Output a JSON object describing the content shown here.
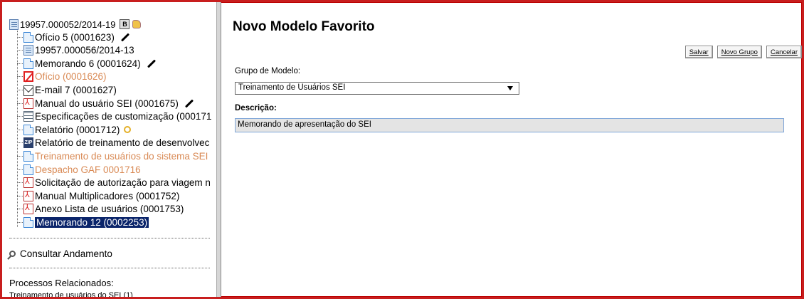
{
  "tree": {
    "root": {
      "label": "19957.000052/2014-19",
      "badge": "B"
    },
    "items": [
      {
        "label": "Ofício 5 (0001623)",
        "icon": "document-icon",
        "marker": "pencil",
        "faded": false
      },
      {
        "label": "19957.000056/2014-13",
        "icon": "process-icon",
        "marker": "",
        "faded": false
      },
      {
        "label": "Memorando 6 (0001624)",
        "icon": "document-icon",
        "marker": "pencil",
        "faded": false
      },
      {
        "label": "Ofício (0001626)",
        "icon": "cancelled-icon",
        "marker": "",
        "faded": true
      },
      {
        "label": "E-mail 7 (0001627)",
        "icon": "email-icon",
        "marker": "",
        "faded": false
      },
      {
        "label": "Manual do usuário SEI (0001675)",
        "icon": "pdf-icon",
        "marker": "pencil",
        "faded": false
      },
      {
        "label": "Especificações de customização (000171",
        "icon": "spreadsheet-icon",
        "marker": "",
        "faded": false
      },
      {
        "label": "Relatório (0001712)",
        "icon": "document-icon",
        "marker": "key",
        "faded": false
      },
      {
        "label": "Relatório de treinamento de desenvolvec",
        "icon": "zip-icon",
        "marker": "",
        "faded": false
      },
      {
        "label": "Treinamento de usuários do sistema SEI",
        "icon": "document-icon",
        "marker": "",
        "faded": true
      },
      {
        "label": "Despacho GAF 0001716",
        "icon": "document-icon",
        "marker": "",
        "faded": true
      },
      {
        "label": "Solicitação de autorização para viagem n",
        "icon": "pdf-icon",
        "marker": "",
        "faded": false
      },
      {
        "label": "Manual Multiplicadores (0001752)",
        "icon": "pdf-icon",
        "marker": "",
        "faded": false
      },
      {
        "label": "Anexo Lista de usuários (0001753)",
        "icon": "pdf-icon",
        "marker": "",
        "faded": false
      },
      {
        "label": "Memorando 12 (0002253)",
        "icon": "document-icon",
        "marker": "",
        "faded": false,
        "selected": true
      }
    ],
    "consultar": "Consultar Andamento",
    "related_title": "Processos Relacionados:",
    "related_item": "Treinamento de usuários do SEI (1)"
  },
  "form": {
    "title": "Novo Modelo Favorito",
    "buttons": {
      "save": "Salvar",
      "new_group": "Novo Grupo",
      "cancel": "Cancelar"
    },
    "group_label": "Grupo de Modelo:",
    "group_value": "Treinamento de Usuários SEI",
    "desc_label": "Descrição:",
    "desc_value": "Memorando de apresentação do SEI"
  },
  "colors": {
    "frame": "#c81e1e",
    "faded_text": "#d98a55",
    "selection": "#0a246a"
  }
}
